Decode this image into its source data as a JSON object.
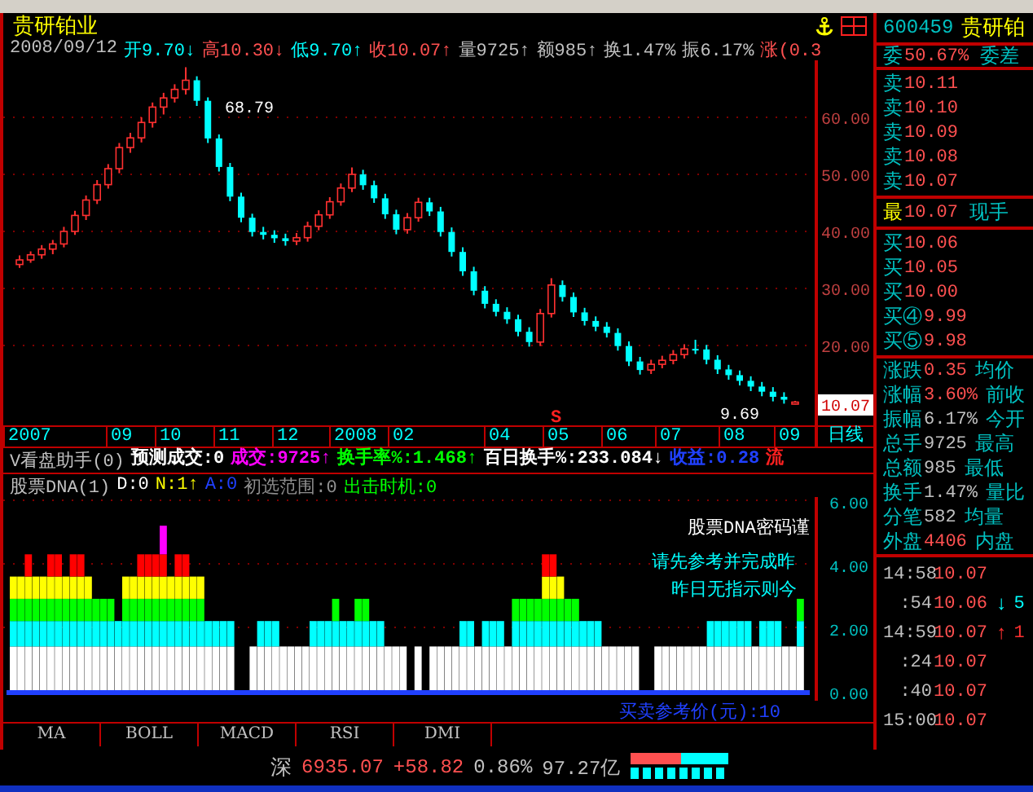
{
  "title": "贵研铂业",
  "info": {
    "date": "2008/09/12",
    "items": [
      {
        "text": "开9.70↓",
        "color": "#00ffff"
      },
      {
        "text": "高10.30↓",
        "color": "#ff5050"
      },
      {
        "text": "低9.70↑",
        "color": "#00ffff"
      },
      {
        "text": "收10.07↑",
        "color": "#ff5050"
      },
      {
        "text": "量9725↑",
        "color": "#c0c0c0"
      },
      {
        "text": "额985↑",
        "color": "#c0c0c0"
      },
      {
        "text": "换1.47%",
        "color": "#c0c0c0"
      },
      {
        "text": "振6.17%",
        "color": "#c0c0c0"
      },
      {
        "text": "涨(0.3",
        "color": "#ff5050"
      }
    ]
  },
  "price_chart": {
    "high_label": "68.79",
    "low_label": "9.69",
    "last_price": "10.07",
    "signal": "S",
    "chart_data": {
      "type": "candlestick",
      "grid": true,
      "ylim": [
        6,
        70
      ],
      "yticks": [
        {
          "value": 60,
          "label": "60.00"
        },
        {
          "value": 50,
          "label": "50.00"
        },
        {
          "value": 40,
          "label": "40.00"
        },
        {
          "value": 30,
          "label": "30.00"
        },
        {
          "value": 20,
          "label": "20.00"
        }
      ],
      "ohlc": [
        [
          34.2,
          35.8,
          33.6,
          35.0
        ],
        [
          35.0,
          36.5,
          34.5,
          35.9
        ],
        [
          35.9,
          37.6,
          35.2,
          36.9
        ],
        [
          36.9,
          38.5,
          36.0,
          37.8
        ],
        [
          37.8,
          40.8,
          37.2,
          40.0
        ],
        [
          40.0,
          43.6,
          39.4,
          42.8
        ],
        [
          42.8,
          46.3,
          42.0,
          45.5
        ],
        [
          45.5,
          49.0,
          44.8,
          48.2
        ],
        [
          48.2,
          51.8,
          47.5,
          51.0
        ],
        [
          51.0,
          55.5,
          50.2,
          54.7
        ],
        [
          54.7,
          57.3,
          53.8,
          56.4
        ],
        [
          56.4,
          60.0,
          55.6,
          59.1
        ],
        [
          59.1,
          62.6,
          58.2,
          61.8
        ],
        [
          61.8,
          64.3,
          60.5,
          63.4
        ],
        [
          63.4,
          65.8,
          62.6,
          64.9
        ],
        [
          64.9,
          68.79,
          64.0,
          66.5
        ],
        [
          66.5,
          67.2,
          62.0,
          62.9
        ],
        [
          62.9,
          63.5,
          55.5,
          56.3
        ],
        [
          56.3,
          57.0,
          50.5,
          51.3
        ],
        [
          51.3,
          52.0,
          45.3,
          46.1
        ],
        [
          46.1,
          46.8,
          41.6,
          42.4
        ],
        [
          42.4,
          43.1,
          39.1,
          39.9
        ],
        [
          39.9,
          40.8,
          38.6,
          39.4
        ],
        [
          39.4,
          40.2,
          38.0,
          38.8
        ],
        [
          38.8,
          39.6,
          37.5,
          38.3
        ],
        [
          38.3,
          39.7,
          37.6,
          38.9
        ],
        [
          38.9,
          41.7,
          38.2,
          40.9
        ],
        [
          40.9,
          43.7,
          40.2,
          42.9
        ],
        [
          42.9,
          46.0,
          42.2,
          45.2
        ],
        [
          45.2,
          48.4,
          44.5,
          47.6
        ],
        [
          47.6,
          51.2,
          46.9,
          50.0
        ],
        [
          50.0,
          50.8,
          47.3,
          48.1
        ],
        [
          48.1,
          48.9,
          45.0,
          45.8
        ],
        [
          45.8,
          46.6,
          42.2,
          43.0
        ],
        [
          43.0,
          43.8,
          39.5,
          40.3
        ],
        [
          40.3,
          43.2,
          39.6,
          42.4
        ],
        [
          42.4,
          45.9,
          41.7,
          45.1
        ],
        [
          45.1,
          45.9,
          42.7,
          43.5
        ],
        [
          43.5,
          44.3,
          39.1,
          39.9
        ],
        [
          39.9,
          40.7,
          35.6,
          36.4
        ],
        [
          36.4,
          37.2,
          32.2,
          33.0
        ],
        [
          33.0,
          33.8,
          28.8,
          29.6
        ],
        [
          29.6,
          30.4,
          26.5,
          27.3
        ],
        [
          27.3,
          28.1,
          25.1,
          25.9
        ],
        [
          25.9,
          26.7,
          23.8,
          24.6
        ],
        [
          24.6,
          25.4,
          21.6,
          22.4
        ],
        [
          22.4,
          23.2,
          19.8,
          20.6
        ],
        [
          20.6,
          26.4,
          19.9,
          25.6
        ],
        [
          25.6,
          31.8,
          24.9,
          30.6
        ],
        [
          30.6,
          31.4,
          27.7,
          28.5
        ],
        [
          28.5,
          29.3,
          25.0,
          25.8
        ],
        [
          25.8,
          26.6,
          23.5,
          24.3
        ],
        [
          24.3,
          25.1,
          22.5,
          23.3
        ],
        [
          23.3,
          24.1,
          21.4,
          22.2
        ],
        [
          22.2,
          23.0,
          19.1,
          19.9
        ],
        [
          19.9,
          20.7,
          16.4,
          17.2
        ],
        [
          17.2,
          18.0,
          14.9,
          15.7
        ],
        [
          15.7,
          17.5,
          15.0,
          16.7
        ],
        [
          16.7,
          18.2,
          16.0,
          17.4
        ],
        [
          17.4,
          19.2,
          16.7,
          18.4
        ],
        [
          18.4,
          20.2,
          17.7,
          19.4
        ],
        [
          19.4,
          21.0,
          18.5,
          19.3
        ],
        [
          19.3,
          20.1,
          16.7,
          17.5
        ],
        [
          17.5,
          18.3,
          15.0,
          15.8
        ],
        [
          15.8,
          16.6,
          14.0,
          14.8
        ],
        [
          14.8,
          15.6,
          13.0,
          13.8
        ],
        [
          13.8,
          14.6,
          12.0,
          12.8
        ],
        [
          12.8,
          13.6,
          11.1,
          11.9
        ],
        [
          11.9,
          12.7,
          10.2,
          11.0
        ],
        [
          11.0,
          11.8,
          9.8,
          10.5
        ],
        [
          9.72,
          10.3,
          9.69,
          10.07
        ]
      ]
    }
  },
  "dates": [
    "2007",
    "09",
    "10",
    "11",
    "12",
    "2008",
    "02",
    "04",
    "05",
    "06",
    "07",
    "08",
    "09"
  ],
  "period": "日线",
  "indicator": {
    "name": "V看盘助手(0)",
    "items": [
      {
        "text": "预测成交:0",
        "color": "#ffffff"
      },
      {
        "text": "成交:9725↑",
        "color": "#ff00ff"
      },
      {
        "text": "换手率%:1.468↑",
        "color": "#00ff00"
      },
      {
        "text": "百日换手%:233.084↓",
        "color": "#ffffff"
      },
      {
        "text": "收益:0.28",
        "color": "#2040ff"
      },
      {
        "text": "流",
        "color": "#ff2020"
      }
    ]
  },
  "dna": {
    "name": "股票DNA(1)",
    "items": [
      {
        "text": "D:0",
        "color": "#ffffff"
      },
      {
        "text": "N:1↑",
        "color": "#ffff00"
      },
      {
        "text": "A:0",
        "color": "#2040ff"
      },
      {
        "text": "初选范围:0",
        "color": "#909090"
      },
      {
        "text": "出击时机:0",
        "color": "#00ff00"
      }
    ],
    "axis": [
      "6.00",
      "4.00",
      "2.00",
      "0.00"
    ],
    "notes": [
      {
        "text": "股票DNA密码谨",
        "color": "#ffffff"
      },
      {
        "text": "请先参考并完成昨",
        "color": "#00ffff"
      },
      {
        "text": "昨日无指示则今",
        "color": "#00ffff"
      }
    ],
    "reference": "买卖参考价(元):10"
  },
  "tabs": [
    "MA",
    "BOLL",
    "MACD",
    "RSI",
    "DMI"
  ],
  "quote": {
    "code": "600459",
    "name": "贵研铂",
    "ratio": {
      "label": "委",
      "value": "50.67%",
      "label2": "委差"
    },
    "sells": [
      {
        "label": "卖",
        "value": "10.11"
      },
      {
        "label": "卖",
        "value": "10.10"
      },
      {
        "label": "卖",
        "value": "10.09"
      },
      {
        "label": "卖",
        "value": "10.08"
      },
      {
        "label": "卖",
        "value": "10.07"
      }
    ],
    "last": {
      "label": "最",
      "value": "10.07",
      "label2": "现手"
    },
    "buys": [
      {
        "label": "买",
        "value": "10.06"
      },
      {
        "label": "买",
        "value": "10.05"
      },
      {
        "label": "买",
        "value": "10.00"
      },
      {
        "label": "买④",
        "value": "9.99"
      },
      {
        "label": "买⑤",
        "value": "9.98"
      }
    ],
    "stats": [
      {
        "label": "涨跌",
        "value": "0.35",
        "label2": "均价",
        "color": "#ff5050"
      },
      {
        "label": "涨幅",
        "value": "3.60%",
        "label2": "前收",
        "color": "#ff5050"
      },
      {
        "label": "振幅",
        "value": "6.17%",
        "label2": "今开",
        "color": "#c0c0c0"
      },
      {
        "label": "总手",
        "value": "9725",
        "label2": "最高",
        "color": "#c0c0c0"
      },
      {
        "label": "总额",
        "value": "985",
        "label2": "最低",
        "color": "#c0c0c0"
      },
      {
        "label": "换手",
        "value": "1.47%",
        "label2": "量比",
        "color": "#c0c0c0"
      },
      {
        "label": "分笔",
        "value": "582",
        "label2": "均量",
        "color": "#c0c0c0"
      },
      {
        "label": "外盘",
        "value": "4406",
        "label2": "内盘",
        "color": "#ff5050"
      }
    ],
    "ticks": [
      {
        "time": "14:58",
        "price": "10.07"
      },
      {
        "time": ":54",
        "price": "10.06",
        "arrow": "↓",
        "volume": "5",
        "color": "#00ffff"
      },
      {
        "time": "14:59",
        "price": "10.07",
        "arrow": "↑",
        "volume": "1",
        "color": "#ff3030"
      },
      {
        "time": ":24",
        "price": "10.07"
      },
      {
        "time": ":40",
        "price": "10.07"
      },
      {
        "time": "15:00",
        "price": "10.07"
      }
    ]
  },
  "status": {
    "market": "深",
    "index": "6935.07",
    "change": "+58.82",
    "percent": "0.86%",
    "amount": "97.27亿"
  }
}
